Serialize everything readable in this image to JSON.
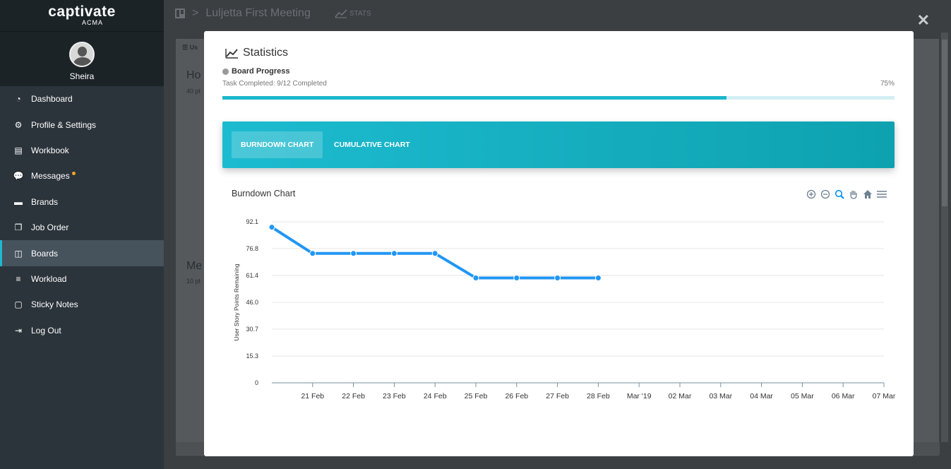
{
  "sidebar": {
    "brand": "captivate",
    "brand_sub": "ACMA",
    "user_name": "Sheira",
    "items": [
      {
        "label": "Dashboard",
        "icon": "dashboard-icon"
      },
      {
        "label": "Profile & Settings",
        "icon": "gears-icon"
      },
      {
        "label": "Workbook",
        "icon": "book-icon"
      },
      {
        "label": "Messages",
        "icon": "chat-icon",
        "badge": true
      },
      {
        "label": "Brands",
        "icon": "briefcase-icon"
      },
      {
        "label": "Job Order",
        "icon": "copy-icon"
      },
      {
        "label": "Boards",
        "icon": "board-icon",
        "active": true
      },
      {
        "label": "Workload",
        "icon": "lines-icon"
      },
      {
        "label": "Sticky Notes",
        "icon": "note-icon"
      },
      {
        "label": "Log Out",
        "icon": "logout-icon"
      }
    ]
  },
  "topbar": {
    "breadcrumb_sep": ">",
    "board_title": "Luljetta First Meeting",
    "stats_label": "STATS"
  },
  "background": {
    "col1_title": "Ho",
    "col1_points": "40 pt",
    "col2_title": "Me",
    "col2_points": "10 pt",
    "col_header": "Us"
  },
  "modal": {
    "title": "Statistics",
    "progress_label": "Board Progress",
    "task_completed": "Task Completed: 9/12 Completed",
    "percent": "75%",
    "progress_value": 0.75,
    "tabs": {
      "burndown": "BURNDOWN CHART",
      "cumulative": "CUMULATIVE CHART"
    },
    "chart_title": "Burndown Chart",
    "toolbar_icons": [
      "zoom-in-icon",
      "zoom-out-icon",
      "search-zoom-icon",
      "pan-hand-icon",
      "home-icon",
      "menu-icon"
    ]
  },
  "colors": {
    "accent": "#1cb8cd",
    "line": "#2196f3",
    "sidebar": "#2c343b"
  },
  "chart_data": {
    "type": "line",
    "title": "Burndown Chart",
    "ylabel": "User Story Points Remaining",
    "xlabel": "",
    "ylim": [
      0,
      92.1
    ],
    "y_ticks": [
      "0",
      "15.3",
      "30.7",
      "46.0",
      "61.4",
      "76.8",
      "92.1"
    ],
    "x_ticks": [
      "21 Feb",
      "22 Feb",
      "23 Feb",
      "24 Feb",
      "25 Feb",
      "26 Feb",
      "27 Feb",
      "28 Feb",
      "Mar '19",
      "02 Mar",
      "03 Mar",
      "04 Mar",
      "05 Mar",
      "06 Mar",
      "07 Mar"
    ],
    "series": [
      {
        "x": [
          "20 Feb",
          "21 Feb",
          "22 Feb",
          "23 Feb",
          "24 Feb",
          "25 Feb",
          "26 Feb",
          "27 Feb",
          "28 Feb"
        ],
        "values": [
          89,
          74,
          74,
          74,
          74,
          60,
          60,
          60,
          60
        ]
      }
    ],
    "grid": true
  }
}
